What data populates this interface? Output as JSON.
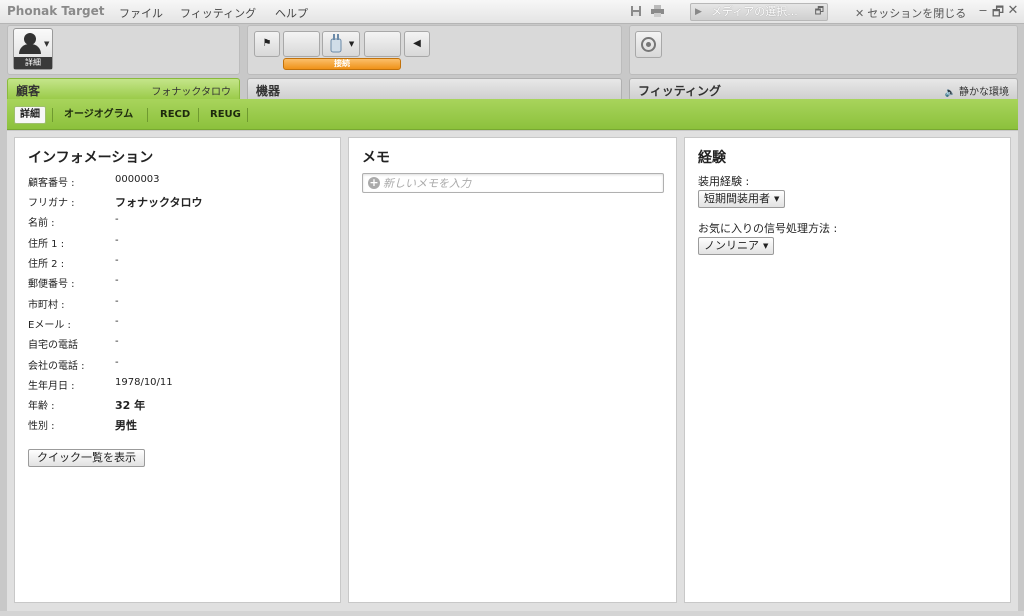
{
  "app": {
    "title": "Phonak Target"
  },
  "menu": [
    "ファイル",
    "フィッティング",
    "ヘルプ"
  ],
  "titlebar": {
    "media_select": "メディアの選択...",
    "close_session": "セッションを閉じる"
  },
  "toolbar": {
    "user_button_label": "詳細",
    "connect_label": "接続"
  },
  "sections": {
    "client": {
      "label": "顧客",
      "name": "フォナックタロウ"
    },
    "devices": {
      "label": "機器"
    },
    "fitting": {
      "label": "フィッティング",
      "environment": "静かな環境"
    }
  },
  "subnav": [
    "詳細",
    "オージオグラム",
    "RECD",
    "REUG"
  ],
  "info": {
    "title": "インフォメーション",
    "rows": [
      {
        "label": "顧客番号 :",
        "value": "0000003",
        "bold": false
      },
      {
        "label": "フリガナ :",
        "value": "フォナックタロウ",
        "bold": true
      },
      {
        "label": "名前 :",
        "value": "-",
        "bold": false
      },
      {
        "label": "住所 1 :",
        "value": "-",
        "bold": false
      },
      {
        "label": "住所 2 :",
        "value": "-",
        "bold": false
      },
      {
        "label": "郵便番号 :",
        "value": "-",
        "bold": false
      },
      {
        "label": "市町村 :",
        "value": "-",
        "bold": false
      },
      {
        "label": "Eメール :",
        "value": "-",
        "bold": false
      },
      {
        "label": "自宅の電話",
        "value": "-",
        "bold": false
      },
      {
        "label": "会社の電話 :",
        "value": "-",
        "bold": false
      },
      {
        "label": "生年月日 :",
        "value": "1978/10/11",
        "bold": false
      },
      {
        "label": "年齢 :",
        "value": "32 年",
        "bold": true
      },
      {
        "label": "性別 :",
        "value": "男性",
        "bold": true
      }
    ],
    "quick_button": "クイック一覧を表示"
  },
  "memo": {
    "title": "メモ",
    "placeholder": "新しいメモを入力"
  },
  "experience": {
    "title": "経験",
    "usage_label": "装用経験 :",
    "usage_value": "短期間装用者",
    "signal_label": "お気に入りの信号処理方法 :",
    "signal_value": "ノンリニア"
  }
}
